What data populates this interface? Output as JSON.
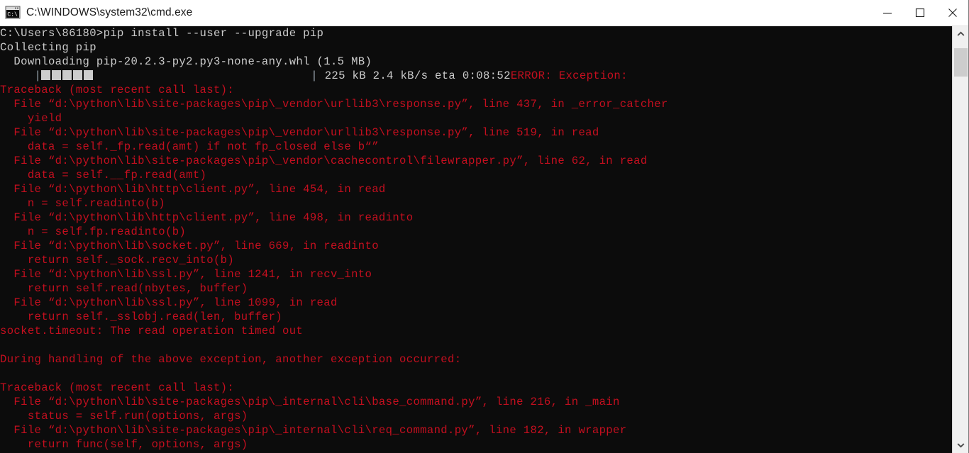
{
  "window": {
    "title": "C:\\WINDOWS\\system32\\cmd.exe",
    "icon": "cmd-console-icon",
    "controls": {
      "minimize_label": "Minimize",
      "maximize_label": "Maximize",
      "close_label": "Close"
    },
    "titlebar_bg": "#ffffff",
    "console_bg": "#0c0c0c",
    "text_color": "#cccccc",
    "error_color": "#c50f1f"
  },
  "scrollbar": {
    "up_arrow": "chevron-up-icon",
    "down_arrow": "chevron-down-icon",
    "thumb_label": "scrollbar-thumb"
  },
  "console": {
    "prompt": "C:\\Users\\86180>",
    "command": "pip install --user --upgrade pip",
    "lines": [
      {
        "id": "l01",
        "color": "gray",
        "text": "C:\\Users\\86180>pip install --user --upgrade pip"
      },
      {
        "id": "l02",
        "color": "gray",
        "text": "Collecting pip"
      },
      {
        "id": "l03",
        "color": "gray",
        "text": "  Downloading pip-20.2.3-py2.py3-none-any.whl (1.5 MB)"
      },
      {
        "id": "l04",
        "color": "progress",
        "text": "     |█████                           | 225 kB 2.4 kB/s eta 0:08:52"
      },
      {
        "id": "l04b",
        "color": "red",
        "text": "ERROR: Exception:"
      },
      {
        "id": "l05",
        "color": "red",
        "text": "Traceback (most recent call last):"
      },
      {
        "id": "l06",
        "color": "red",
        "text": "  File “d:\\python\\lib\\site-packages\\pip\\_vendor\\urllib3\\response.py”, line 437, in _error_catcher"
      },
      {
        "id": "l07",
        "color": "red",
        "text": "    yield"
      },
      {
        "id": "l08",
        "color": "red",
        "text": "  File “d:\\python\\lib\\site-packages\\pip\\_vendor\\urllib3\\response.py”, line 519, in read"
      },
      {
        "id": "l09",
        "color": "red",
        "text": "    data = self._fp.read(amt) if not fp_closed else b“”"
      },
      {
        "id": "l10",
        "color": "red",
        "text": "  File “d:\\python\\lib\\site-packages\\pip\\_vendor\\cachecontrol\\filewrapper.py”, line 62, in read"
      },
      {
        "id": "l11",
        "color": "red",
        "text": "    data = self.__fp.read(amt)"
      },
      {
        "id": "l12",
        "color": "red",
        "text": "  File “d:\\python\\lib\\http\\client.py”, line 454, in read"
      },
      {
        "id": "l13",
        "color": "red",
        "text": "    n = self.readinto(b)"
      },
      {
        "id": "l14",
        "color": "red",
        "text": "  File “d:\\python\\lib\\http\\client.py”, line 498, in readinto"
      },
      {
        "id": "l15",
        "color": "red",
        "text": "    n = self.fp.readinto(b)"
      },
      {
        "id": "l16",
        "color": "red",
        "text": "  File “d:\\python\\lib\\socket.py”, line 669, in readinto"
      },
      {
        "id": "l17",
        "color": "red",
        "text": "    return self._sock.recv_into(b)"
      },
      {
        "id": "l18",
        "color": "red",
        "text": "  File “d:\\python\\lib\\ssl.py”, line 1241, in recv_into"
      },
      {
        "id": "l19",
        "color": "red",
        "text": "    return self.read(nbytes, buffer)"
      },
      {
        "id": "l20",
        "color": "red",
        "text": "  File “d:\\python\\lib\\ssl.py”, line 1099, in read"
      },
      {
        "id": "l21",
        "color": "red",
        "text": "    return self._sslobj.read(len, buffer)"
      },
      {
        "id": "l22",
        "color": "red",
        "text": "socket.timeout: The read operation timed out"
      },
      {
        "id": "l23",
        "color": "red",
        "text": ""
      },
      {
        "id": "l24",
        "color": "red",
        "text": "During handling of the above exception, another exception occurred:"
      },
      {
        "id": "l25",
        "color": "red",
        "text": ""
      },
      {
        "id": "l26",
        "color": "red",
        "text": "Traceback (most recent call last):"
      },
      {
        "id": "l27",
        "color": "red",
        "text": "  File “d:\\python\\lib\\site-packages\\pip\\_internal\\cli\\base_command.py”, line 216, in _main"
      },
      {
        "id": "l28",
        "color": "red",
        "text": "    status = self.run(options, args)"
      },
      {
        "id": "l29",
        "color": "red",
        "text": "  File “d:\\python\\lib\\site-packages\\pip\\_internal\\cli\\req_command.py”, line 182, in wrapper"
      },
      {
        "id": "l30",
        "color": "red",
        "text": "    return func(self, options, args)"
      }
    ],
    "progress": {
      "filled_blocks": 5,
      "total_width_chars": 30,
      "downloaded": "225 kB",
      "speed": "2.4 kB/s",
      "eta": "0:08:52",
      "package": "pip-20.2.3-py2.py3-none-any.whl",
      "package_size": "1.5 MB"
    }
  }
}
